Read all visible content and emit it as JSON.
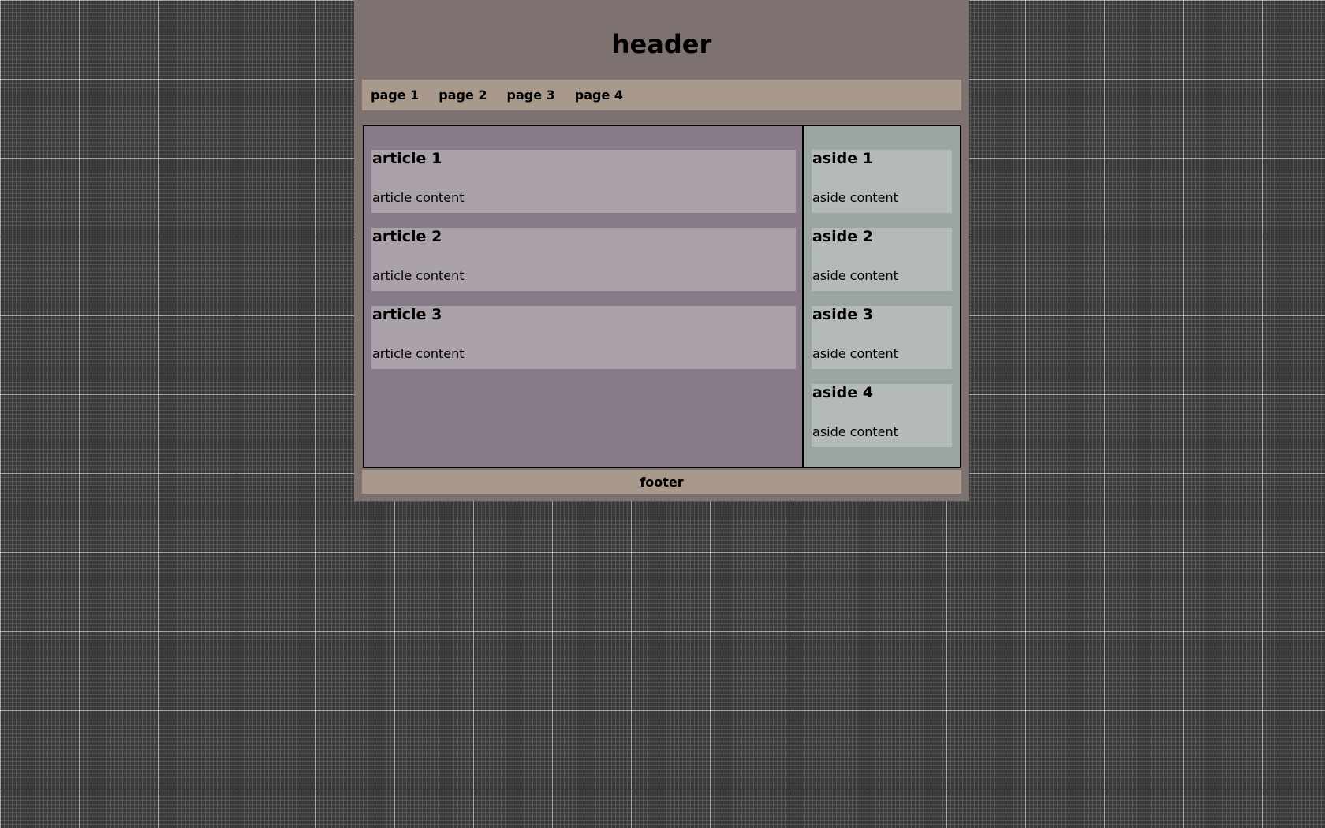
{
  "header": {
    "title": "header"
  },
  "nav": {
    "items": [
      {
        "label": "page 1"
      },
      {
        "label": "page 2"
      },
      {
        "label": "page 3"
      },
      {
        "label": "page 4"
      }
    ]
  },
  "articles": [
    {
      "title": "article 1",
      "content": "article content"
    },
    {
      "title": "article 2",
      "content": "article content"
    },
    {
      "title": "article 3",
      "content": "article content"
    }
  ],
  "asides": [
    {
      "title": "aside 1",
      "content": "aside content"
    },
    {
      "title": "aside 2",
      "content": "aside content"
    },
    {
      "title": "aside 3",
      "content": "aside content"
    },
    {
      "title": "aside 4",
      "content": "aside content"
    }
  ],
  "footer": {
    "label": "footer"
  }
}
